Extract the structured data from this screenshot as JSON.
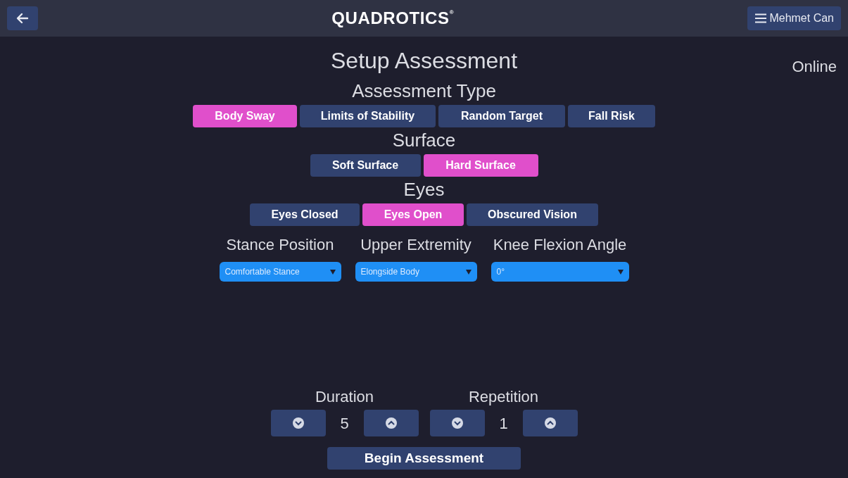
{
  "header": {
    "brand": "QUADROTICS",
    "brand_mark": "®",
    "user": "Mehmet Can"
  },
  "title": "Setup Assessment",
  "status": "Online",
  "groups": [
    {
      "label": "Assessment Type",
      "options": [
        {
          "label": "Body Sway",
          "selected": true
        },
        {
          "label": "Limits of Stability",
          "selected": false
        },
        {
          "label": "Random Target",
          "selected": false
        },
        {
          "label": "Fall Risk",
          "selected": false
        }
      ]
    },
    {
      "label": "Surface",
      "options": [
        {
          "label": "Soft Surface",
          "selected": false
        },
        {
          "label": "Hard Surface",
          "selected": true
        }
      ]
    },
    {
      "label": "Eyes",
      "options": [
        {
          "label": "Eyes Closed",
          "selected": false
        },
        {
          "label": "Eyes Open",
          "selected": true
        },
        {
          "label": "Obscured Vision",
          "selected": false
        }
      ]
    }
  ],
  "dropdowns": [
    {
      "label": "Stance Position",
      "value": "Comfortable Stance"
    },
    {
      "label": "Upper Extremity",
      "value": "Elongside Body"
    },
    {
      "label": "Knee Flexion Angle",
      "value": "0°"
    }
  ],
  "steppers": [
    {
      "label": "Duration",
      "value": "5"
    },
    {
      "label": "Repetition",
      "value": "1"
    }
  ],
  "begin_button": "Begin Assessment"
}
